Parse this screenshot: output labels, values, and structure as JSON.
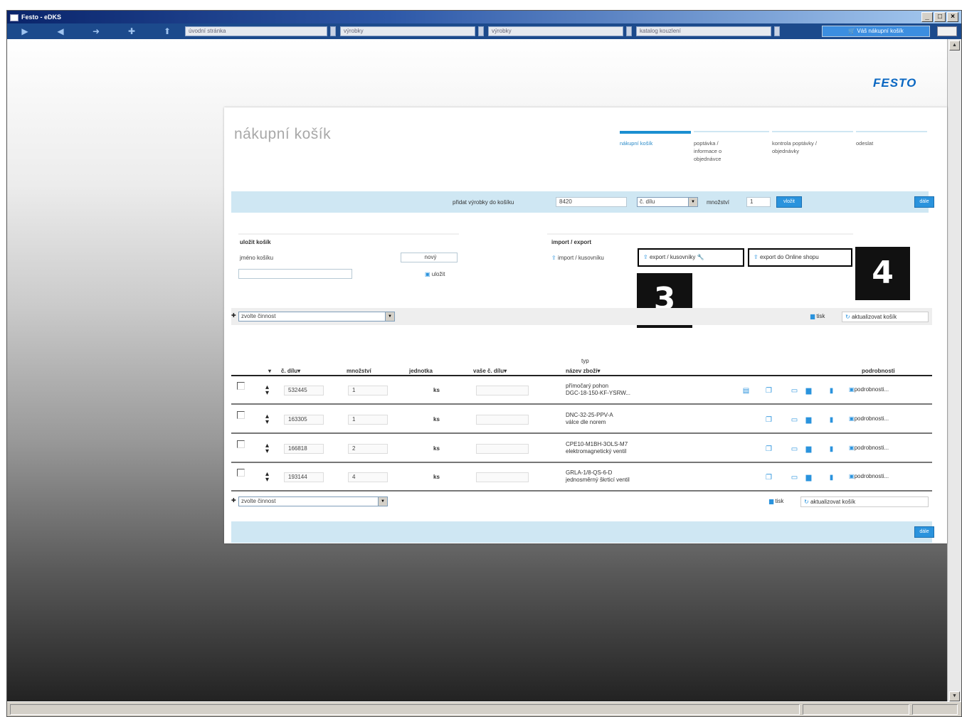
{
  "window": {
    "title": "Festo - eDKS",
    "controls": [
      "_",
      "□",
      "×"
    ]
  },
  "toolbar": {
    "nav_icons": [
      "play-icon",
      "back-icon",
      "forward-icon",
      "plus-icon",
      "up-icon"
    ],
    "nav_glyphs": [
      "▶",
      "◀",
      "➜",
      "✚",
      "⬆"
    ],
    "fields": [
      "úvodní stránka",
      "výrobky",
      "výrobky",
      "katalog kouzlení"
    ],
    "cart_button": "Váš nákupní košík"
  },
  "brand": {
    "logo_text": "FESTO",
    "color": "#0a67c2"
  },
  "panel": {
    "title": "nákupní košík",
    "steps": [
      {
        "lines": [
          "nákupní košík"
        ],
        "active": true
      },
      {
        "lines": [
          "poptávka /",
          "informace o",
          "objednávce"
        ],
        "active": false
      },
      {
        "lines": [
          "kontrola poptávky /",
          "objednávky"
        ],
        "active": false
      },
      {
        "lines": [
          "odeslat"
        ],
        "active": false
      }
    ],
    "add_bar": {
      "label": "přidat výrobky do košíku",
      "value": "8420",
      "select": "č. dílu",
      "qty_label": "množství",
      "qty_value": "1",
      "go_button": "vložit",
      "right_button": "dále"
    },
    "save_cart": {
      "heading": "uložit košík",
      "name_label": "jméno košíku",
      "new_label": "nový",
      "save_label": "uložit"
    },
    "import_export": {
      "heading": "import / export",
      "import_label": "import / kusovníku",
      "export_label": "export / kusovníky",
      "export_shop_label": "export do Online shopu"
    },
    "callouts": [
      "3",
      "4"
    ],
    "action_select": "zvolte činnost",
    "print_label": "tisk",
    "update_label": "aktualizovat košík",
    "columns": {
      "part_no": "č. dílu",
      "qty": "množství",
      "unit": "jednotka",
      "your_part_no": "vaše č. dílu",
      "type": "typ",
      "name": "název zboží",
      "details": "podrobnosti"
    },
    "rows": [
      {
        "part": "532445",
        "qty": "1",
        "unit": "ks",
        "name1": "přímočarý pohon",
        "name2": "DGC-18-150-KF-YSRW..."
      },
      {
        "part": "163305",
        "qty": "1",
        "unit": "ks",
        "name1": "DNC-32-25-PPV-A",
        "name2": "válce dle norem"
      },
      {
        "part": "166818",
        "qty": "2",
        "unit": "ks",
        "name1": "CPE10-M1BH-3OLS-M7",
        "name2": "elektromagnetický ventil"
      },
      {
        "part": "193144",
        "qty": "4",
        "unit": "ks",
        "name1": "GRLA-1/8-QS-6-D",
        "name2": "jednosměrný škrticí ventil"
      }
    ],
    "details_link": "podrobnosti...",
    "bottom_button": "dále"
  },
  "accent_colors": {
    "light_blue": "#cfe7f3",
    "blue": "#2a93dd",
    "titlebar": "#0a246a"
  }
}
